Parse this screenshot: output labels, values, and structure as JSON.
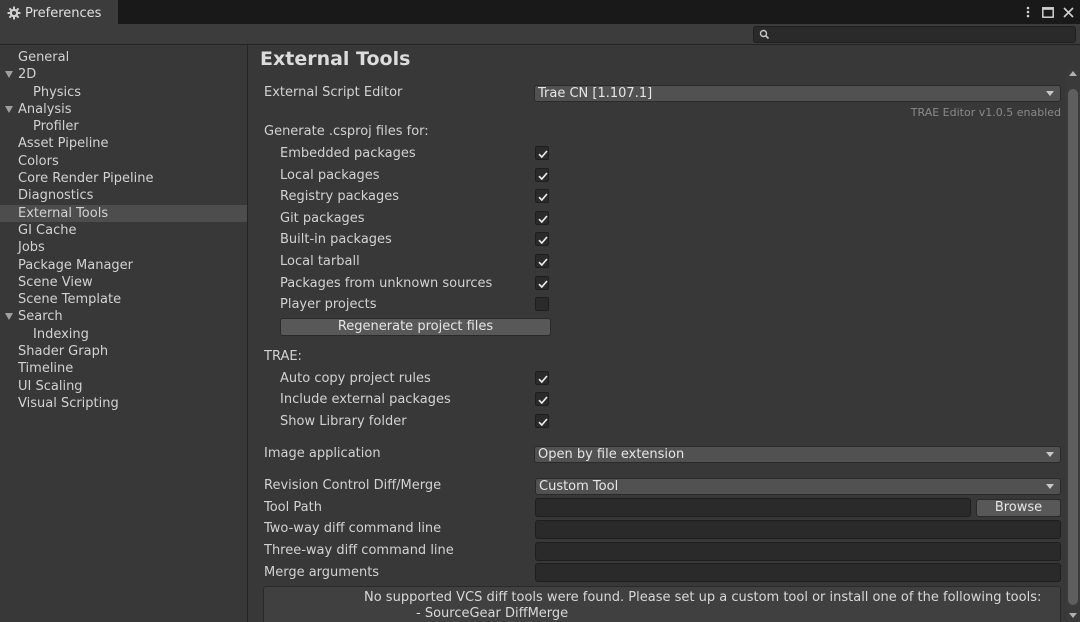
{
  "window": {
    "tab_title": "Preferences",
    "icons": [
      "gear-icon",
      "kebab-menu-icon",
      "maximize-icon",
      "close-icon"
    ]
  },
  "search": {
    "placeholder": "",
    "value": ""
  },
  "sidebar": {
    "items": [
      {
        "label": "General",
        "level": 0,
        "expandable": false
      },
      {
        "label": "2D",
        "level": 0,
        "expandable": true
      },
      {
        "label": "Physics",
        "level": 1,
        "expandable": false
      },
      {
        "label": "Analysis",
        "level": 0,
        "expandable": true
      },
      {
        "label": "Profiler",
        "level": 1,
        "expandable": false
      },
      {
        "label": "Asset Pipeline",
        "level": 0,
        "expandable": false
      },
      {
        "label": "Colors",
        "level": 0,
        "expandable": false
      },
      {
        "label": "Core Render Pipeline",
        "level": 0,
        "expandable": false
      },
      {
        "label": "Diagnostics",
        "level": 0,
        "expandable": false
      },
      {
        "label": "External Tools",
        "level": 0,
        "expandable": false,
        "selected": true
      },
      {
        "label": "GI Cache",
        "level": 0,
        "expandable": false
      },
      {
        "label": "Jobs",
        "level": 0,
        "expandable": false
      },
      {
        "label": "Package Manager",
        "level": 0,
        "expandable": false
      },
      {
        "label": "Scene View",
        "level": 0,
        "expandable": false
      },
      {
        "label": "Scene Template",
        "level": 0,
        "expandable": false
      },
      {
        "label": "Search",
        "level": 0,
        "expandable": true
      },
      {
        "label": "Indexing",
        "level": 1,
        "expandable": false
      },
      {
        "label": "Shader Graph",
        "level": 0,
        "expandable": false
      },
      {
        "label": "Timeline",
        "level": 0,
        "expandable": false
      },
      {
        "label": "UI Scaling",
        "level": 0,
        "expandable": false
      },
      {
        "label": "Visual Scripting",
        "level": 0,
        "expandable": false
      }
    ]
  },
  "main": {
    "title": "External Tools",
    "script_editor": {
      "label": "External Script Editor",
      "value": "Trae CN [1.107.1]",
      "hint": "TRAE Editor v1.0.5 enabled"
    },
    "csproj": {
      "heading": "Generate .csproj files for:",
      "options": [
        {
          "label": "Embedded packages",
          "checked": true
        },
        {
          "label": "Local packages",
          "checked": true
        },
        {
          "label": "Registry packages",
          "checked": true
        },
        {
          "label": "Git packages",
          "checked": true
        },
        {
          "label": "Built-in packages",
          "checked": true
        },
        {
          "label": "Local tarball",
          "checked": true
        },
        {
          "label": "Packages from unknown sources",
          "checked": true
        },
        {
          "label": "Player projects",
          "checked": false
        }
      ],
      "regenerate_label": "Regenerate project files"
    },
    "trae": {
      "heading": "TRAE:",
      "options": [
        {
          "label": "Auto copy project rules",
          "checked": true
        },
        {
          "label": "Include external packages",
          "checked": true
        },
        {
          "label": "Show Library folder",
          "checked": true
        }
      ]
    },
    "image_app": {
      "label": "Image application",
      "value": "Open by file extension"
    },
    "revision": {
      "label": "Revision Control Diff/Merge",
      "value": "Custom Tool"
    },
    "tool_path": {
      "label": "Tool Path",
      "value": "",
      "browse_label": "Browse"
    },
    "two_way": {
      "label": "Two-way diff command line",
      "value": ""
    },
    "three_way": {
      "label": "Three-way diff command line",
      "value": ""
    },
    "merge_args": {
      "label": "Merge arguments",
      "value": ""
    },
    "info": {
      "line1": "No supported VCS diff tools were found. Please set up a custom tool or install one of the following tools:",
      "line2": "- SourceGear DiffMerge"
    }
  }
}
